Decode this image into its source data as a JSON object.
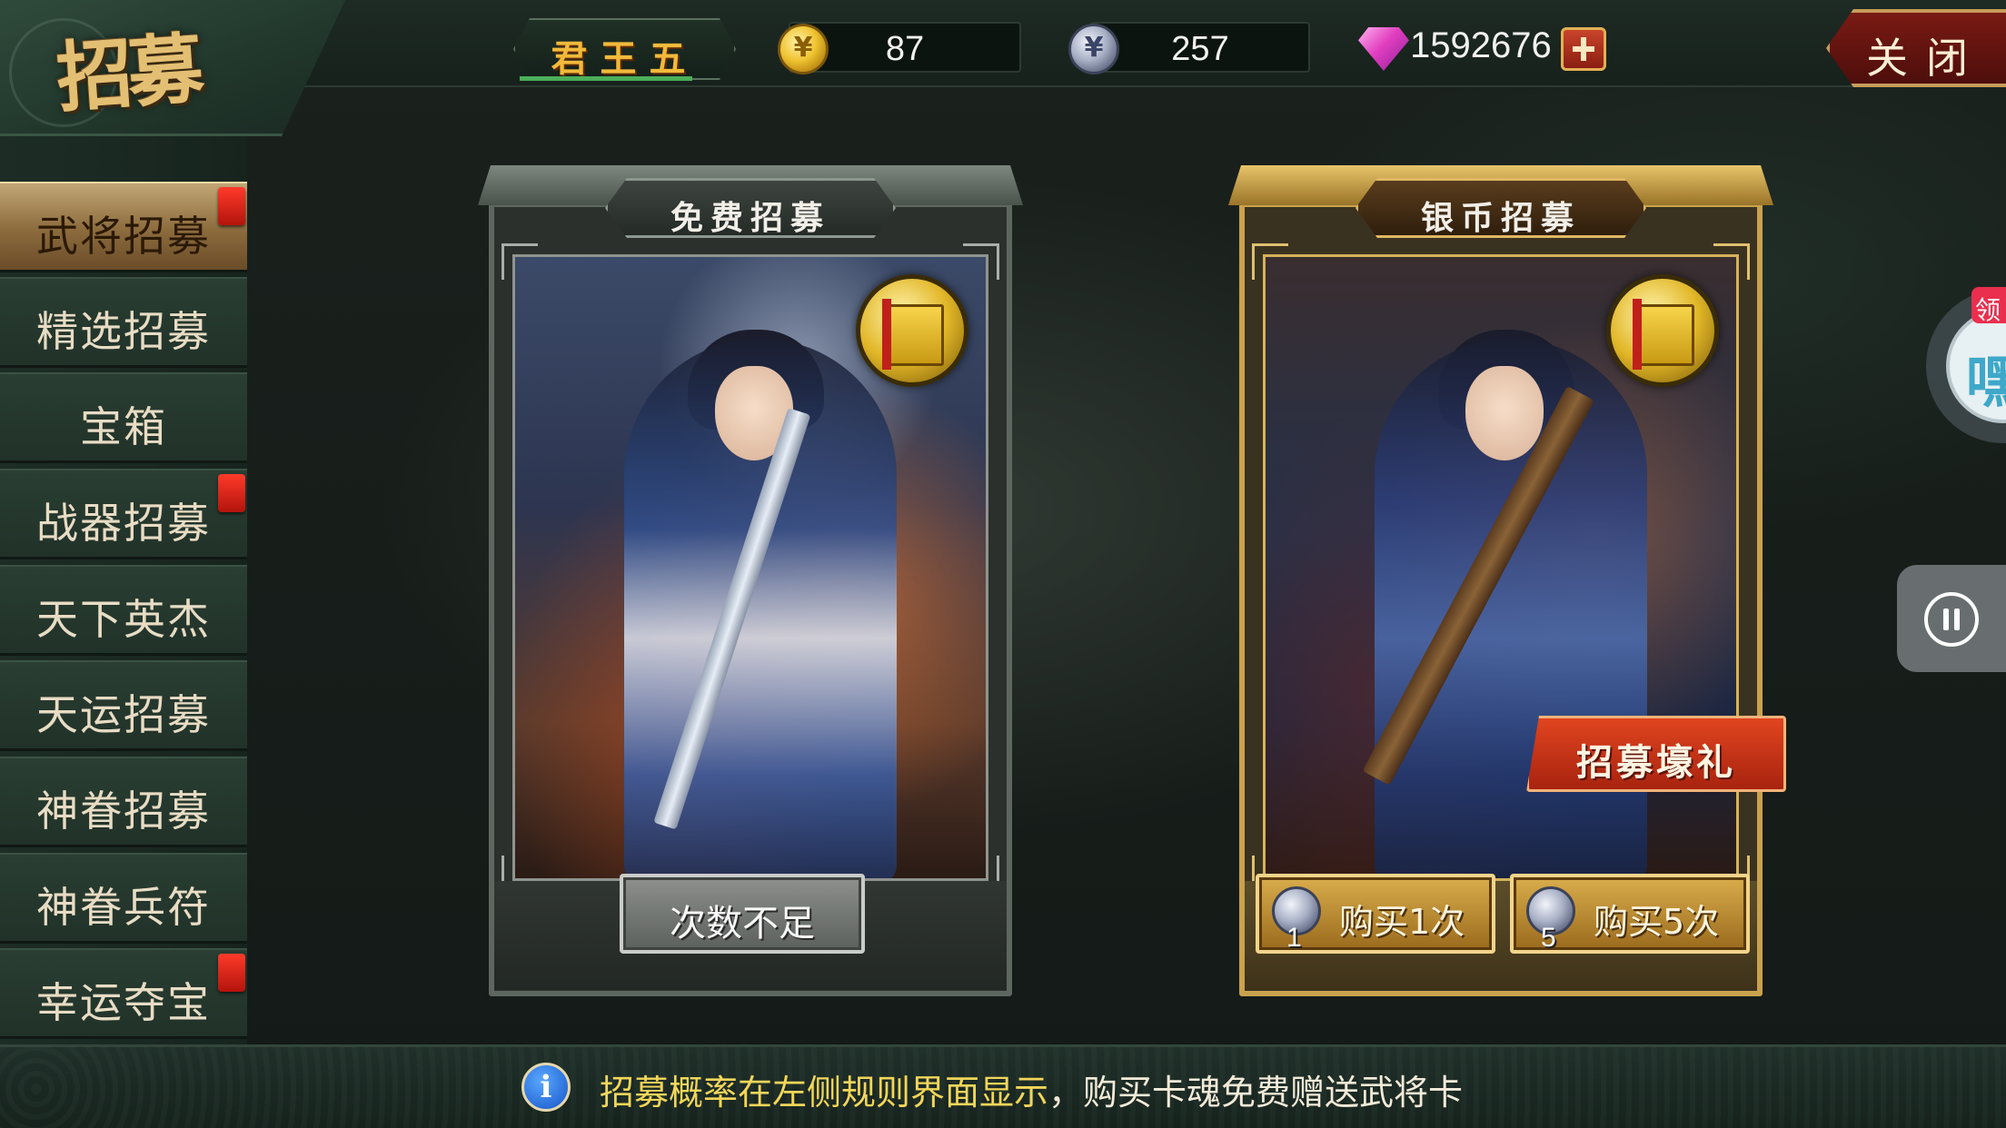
{
  "header": {
    "title": "招募",
    "vip_label": "君王五",
    "gold_amount": "87",
    "silver_amount": "257",
    "gem_amount": "1592676",
    "close_label": "关闭"
  },
  "sidebar": {
    "items": [
      {
        "label": "武将招募",
        "active": true,
        "has_notice": true
      },
      {
        "label": "精选招募",
        "active": false,
        "has_notice": false
      },
      {
        "label": "宝箱",
        "active": false,
        "has_notice": false
      },
      {
        "label": "战器招募",
        "active": false,
        "has_notice": true
      },
      {
        "label": "天下英杰",
        "active": false,
        "has_notice": false
      },
      {
        "label": "天运招募",
        "active": false,
        "has_notice": false
      },
      {
        "label": "神眷招募",
        "active": false,
        "has_notice": false
      },
      {
        "label": "神眷兵符",
        "active": false,
        "has_notice": false
      },
      {
        "label": "幸运夺宝",
        "active": false,
        "has_notice": true
      }
    ]
  },
  "cards": {
    "free": {
      "title": "免费招募",
      "button_label": "次数不足",
      "button_enabled": false
    },
    "silver": {
      "title": "银币招募",
      "gift_banner": "招募壕礼",
      "buy_once_label": "购买1次",
      "buy_once_cost": "1",
      "buy_five_label": "购买5次",
      "buy_five_cost": "5"
    }
  },
  "floating": {
    "gift_tag": "领",
    "widget_glyph": "嘿"
  },
  "footer": {
    "info_highlight": "招募概率在左侧规则界面显示",
    "info_rest": "，购买卡魂免费赠送武将卡"
  },
  "colors": {
    "accent_gold": "#e3bf73",
    "info_yellow": "#f2d65a",
    "vip_green": "#4cae59",
    "notice_red": "#e8271b"
  },
  "icons": [
    "gold-coin-icon",
    "silver-coin-icon",
    "gem-icon",
    "plus-icon",
    "info-icon",
    "pause-icon",
    "card-book-icon"
  ]
}
